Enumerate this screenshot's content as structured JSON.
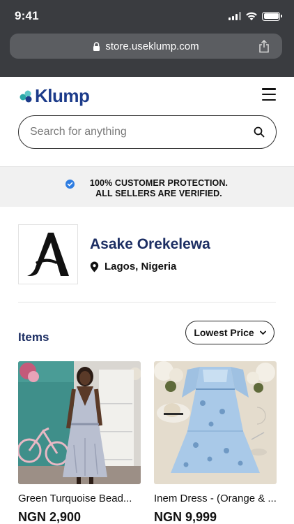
{
  "status_bar": {
    "time": "9:41"
  },
  "browser": {
    "url": "store.useklump.com"
  },
  "header": {
    "logo_text": "Klump"
  },
  "search": {
    "placeholder": "Search for anything"
  },
  "banner": {
    "text": "100% CUSTOMER PROTECTION. ALL SELLERS ARE VERIFIED."
  },
  "seller": {
    "name": "Asake Orekelewa",
    "location": "Lagos, Nigeria"
  },
  "items": {
    "title": "Items",
    "sort_label": "Lowest Price",
    "products": [
      {
        "name": "Green Turquoise Bead...",
        "price": "NGN 2,900"
      },
      {
        "name": "Inem Dress - (Orange & ...",
        "price": "NGN 9,999"
      }
    ]
  },
  "colors": {
    "brand_navy": "#1c2e63",
    "brand_blue": "#1c3b8a",
    "verified_blue": "#2f7de1",
    "chrome_dark": "#3a3c40"
  }
}
